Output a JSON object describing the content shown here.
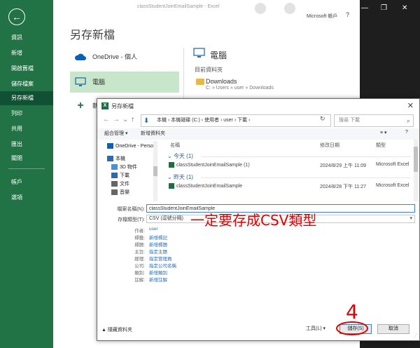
{
  "title_bar": {
    "doc_title": "classStudentJoinEmailSample - Excel",
    "account": "Microsoft 帳戶",
    "help": "?",
    "window_controls": [
      "—",
      "❐",
      "✕"
    ]
  },
  "backstage": {
    "heading": "另存新檔",
    "nav": [
      {
        "label": "資訊"
      },
      {
        "label": "新增"
      },
      {
        "label": "開啟舊檔"
      },
      {
        "label": "儲存檔案"
      },
      {
        "label": "另存新檔",
        "active": true
      },
      {
        "label": "列印"
      },
      {
        "label": "共用"
      },
      {
        "label": "匯出"
      },
      {
        "label": "關閉"
      },
      {
        "label": "帳戶"
      },
      {
        "label": "選項"
      }
    ],
    "places": [
      {
        "label": "OneDrive - 個人",
        "icon": "cloud-icon"
      },
      {
        "label": "電腦",
        "icon": "computer-icon",
        "selected": true
      },
      {
        "label": "新",
        "icon": "plus-icon"
      }
    ],
    "right_title": "電腦",
    "current_folder_label": "目前資料夾",
    "folder_name": "Downloads",
    "folder_path": "C: » Users » user » Downloads"
  },
  "dialog": {
    "title": "另存新檔",
    "close": "✕",
    "address": "本機 › 本機磁碟 (C:) › 使用者 › user › 下載 ›",
    "search_placeholder": "搜尋 下載",
    "toolbar": {
      "organize": "組合管理 ▾",
      "new_folder": "新增資料夾",
      "view": "≡ ▾",
      "help": "?"
    },
    "nav_pane": [
      "OneDrive - Perso",
      "本機",
      "3D 物件",
      "下載",
      "文件",
      "音樂"
    ],
    "columns": [
      "名稱",
      "修改日期",
      "類型"
    ],
    "groups": [
      {
        "label": "今天 (1)",
        "files": [
          {
            "name": "classStudentJoinEmailSample (1)",
            "date": "2024/8/29 上午 11:09",
            "type": "Microsoft Excel"
          }
        ]
      },
      {
        "label": "昨天 (1)",
        "files": [
          {
            "name": "classStudentJoinEmailSample",
            "date": "2024/8/28 下午 11:27",
            "type": "Microsoft Excel"
          }
        ]
      }
    ],
    "filename_label": "檔案名稱(N):",
    "filename_value": "classStudentJoinEmailSample",
    "filetype_label": "存檔類型(T):",
    "filetype_value": "CSV (逗號分隔)",
    "metadata": [
      {
        "label": "作者:",
        "value": "user"
      },
      {
        "label": "標籤:",
        "value": "新增標記"
      },
      {
        "label": "標題:",
        "value": "新增標題"
      },
      {
        "label": "主旨:",
        "value": "指定主題"
      },
      {
        "label": "經理:",
        "value": "指定管理員"
      },
      {
        "label": "公司:",
        "value": "指定公司名稱"
      },
      {
        "label": "類別:",
        "value": "新增類別"
      },
      {
        "label": "註解:",
        "value": "新增註解"
      }
    ],
    "hide_folders": "隱藏資料夾",
    "tools": "工具(L) ▾",
    "save": "儲存(S)",
    "cancel": "取消"
  },
  "annotations": {
    "note": "一定要存成CSV類型",
    "step": "4",
    "color": "#e00000"
  }
}
